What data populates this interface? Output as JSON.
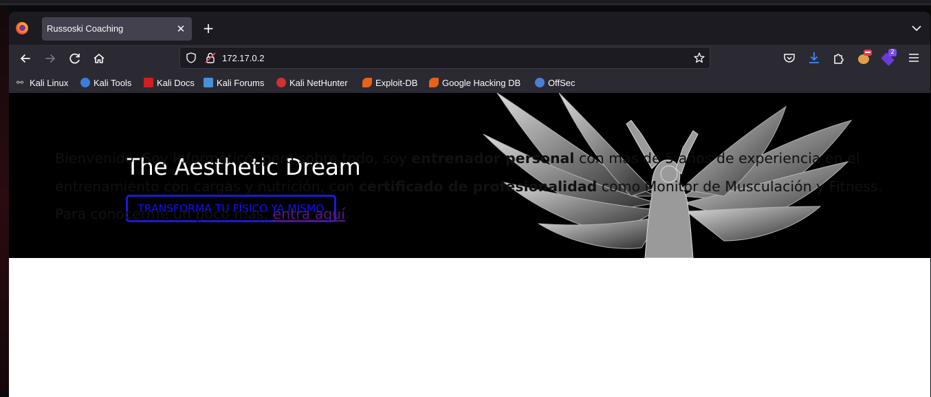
{
  "browser": {
    "tab": {
      "title": "Russoski Coaching"
    },
    "url": "172.17.0.2",
    "bookmarks": [
      {
        "label": "Kali Linux",
        "icon": "kali-dragon-icon",
        "color": "#cfcfcf"
      },
      {
        "label": "Kali Tools",
        "icon": "kali-tools-icon",
        "color": "#3b7ddd"
      },
      {
        "label": "Kali Docs",
        "icon": "kali-docs-icon",
        "color": "#d01f1f"
      },
      {
        "label": "Kali Forums",
        "icon": "kali-forums-icon",
        "color": "#4a90d9"
      },
      {
        "label": "Kali NetHunter",
        "icon": "nethunter-icon",
        "color": "#d23030"
      },
      {
        "label": "Exploit-DB",
        "icon": "exploit-db-icon",
        "color": "#e8621a"
      },
      {
        "label": "Google Hacking DB",
        "icon": "ghdb-icon",
        "color": "#e8621a"
      },
      {
        "label": "OffSec",
        "icon": "offsec-icon",
        "color": "#4a7fd6"
      }
    ],
    "downloads_badge": "2"
  },
  "page": {
    "hero": {
      "title": "The Aesthetic Dream",
      "cta_label": "TRANSFORMA TU FÍSICO YA MISMO",
      "accent": "#1a1ad8"
    },
    "intro": {
      "part1": "Bienvenido. Soy Informático, pero sobre todo, soy ",
      "bold1": "entrenador personal",
      "part2": " con más de 5 años de experiencia en el entrenamiento con cargas y nutrición, con ",
      "bold2": "certificado de profesionalidad",
      "part3": " como Monitor de Musculación y Fitness. Para conocerme un poco más, ",
      "link": "entra aquí",
      "part4": "."
    }
  }
}
